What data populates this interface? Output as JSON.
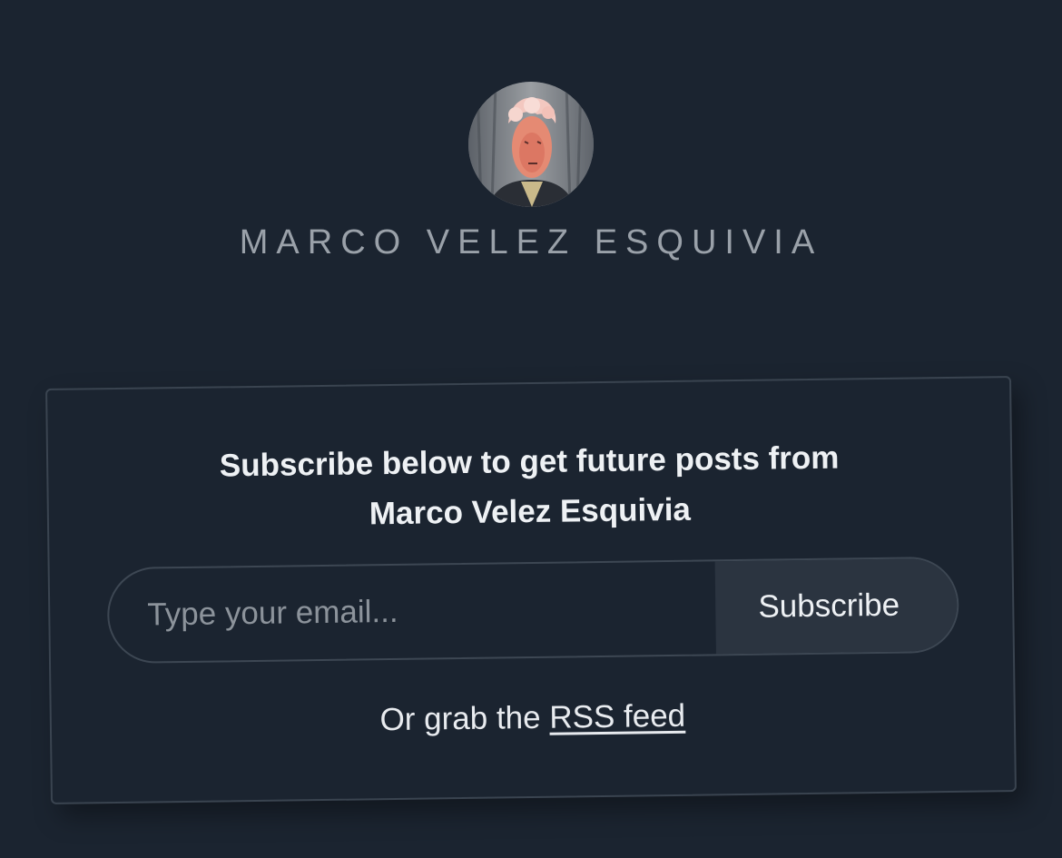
{
  "site": {
    "name": "MARCO VELEZ ESQUIVIA"
  },
  "subscribe": {
    "title_line1": "Subscribe below to get future posts from",
    "title_line2": "Marco Velez Esquivia",
    "email_placeholder": "Type your email...",
    "button_label": "Subscribe",
    "rss_prefix": "Or grab the",
    "rss_link": "RSS feed"
  },
  "colors": {
    "background": "#1b2430",
    "border": "#3a4450",
    "button_bg": "#2b3440",
    "muted_text": "#9aa1a9"
  },
  "icons": {
    "avatar": "author-portrait-painting"
  }
}
